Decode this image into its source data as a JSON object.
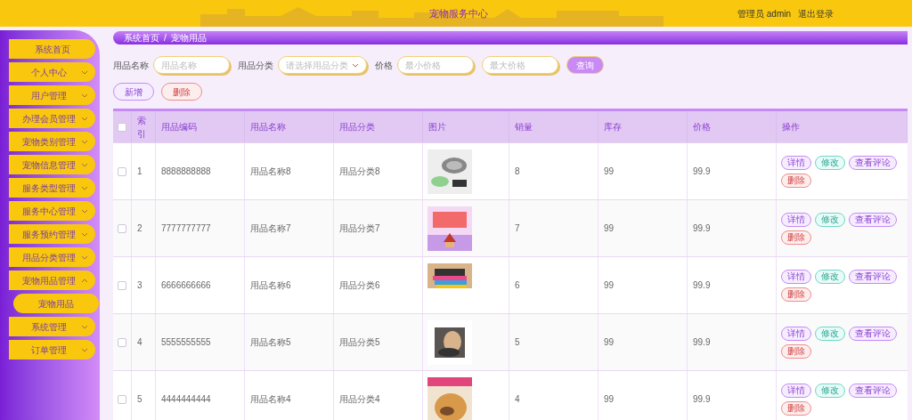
{
  "header": {
    "title": "宠物服务中心",
    "user_label": "管理员 admin",
    "logout": "退出登录"
  },
  "sidebar": {
    "items": [
      {
        "label": "系统首页",
        "kind": "link"
      },
      {
        "label": "个人中心",
        "kind": "menu",
        "expanded": false
      },
      {
        "label": "用户管理",
        "kind": "menu",
        "expanded": false
      },
      {
        "label": "办理会员管理",
        "kind": "menu",
        "expanded": false
      },
      {
        "label": "宠物类别管理",
        "kind": "menu",
        "expanded": false
      },
      {
        "label": "宠物信息管理",
        "kind": "menu",
        "expanded": false
      },
      {
        "label": "服务类型管理",
        "kind": "menu",
        "expanded": false
      },
      {
        "label": "服务中心管理",
        "kind": "menu",
        "expanded": false
      },
      {
        "label": "服务预约管理",
        "kind": "menu",
        "expanded": false
      },
      {
        "label": "用品分类管理",
        "kind": "menu",
        "expanded": false
      },
      {
        "label": "宠物用品管理",
        "kind": "menu",
        "expanded": true,
        "children": [
          {
            "label": "宠物用品"
          }
        ]
      },
      {
        "label": "系统管理",
        "kind": "menu",
        "expanded": false
      },
      {
        "label": "订单管理",
        "kind": "menu",
        "expanded": false
      }
    ]
  },
  "breadcrumb": {
    "items": [
      "系统首页",
      "宠物用品"
    ],
    "separator": "/"
  },
  "filters": [
    {
      "kind": "input",
      "label": "用品名称",
      "placeholder": "用品名称"
    },
    {
      "kind": "select",
      "label": "用品分类",
      "placeholder": "请选择用品分类"
    },
    {
      "kind": "input",
      "label": "价格",
      "placeholder": "最小价格"
    },
    {
      "kind": "input",
      "placeholder": "最大价格"
    }
  ],
  "search_button": "查询",
  "toolbar": [
    {
      "kind": "add",
      "label": "新增"
    },
    {
      "kind": "delete",
      "label": "删除"
    }
  ],
  "table": {
    "select_all": {
      "checked": false
    },
    "columns": [
      "索引",
      "用品编码",
      "用品名称",
      "用品分类",
      "图片",
      "销量",
      "库存",
      "价格",
      "操作"
    ],
    "rows": [
      {
        "checked": false,
        "cells": [
          "1",
          "8888888888",
          "用品名称8",
          "用品分类8"
        ],
        "after": [
          "8",
          "99",
          "99.9"
        ],
        "actions": [
          {
            "kind": "detail",
            "label": "详情"
          },
          {
            "kind": "edit",
            "label": "修改"
          },
          {
            "kind": "comments",
            "label": "查看评论"
          },
          {
            "kind": "delete",
            "label": "删除"
          }
        ]
      },
      {
        "checked": false,
        "cells": [
          "2",
          "7777777777",
          "用品名称7",
          "用品分类7"
        ],
        "after": [
          "7",
          "99",
          "99.9"
        ],
        "actions": [
          {
            "kind": "detail",
            "label": "详情"
          },
          {
            "kind": "edit",
            "label": "修改"
          },
          {
            "kind": "comments",
            "label": "查看评论"
          },
          {
            "kind": "delete",
            "label": "删除"
          }
        ]
      },
      {
        "checked": false,
        "cells": [
          "3",
          "6666666666",
          "用品名称6",
          "用品分类6"
        ],
        "after": [
          "6",
          "99",
          "99.9"
        ],
        "actions": [
          {
            "kind": "detail",
            "label": "详情"
          },
          {
            "kind": "edit",
            "label": "修改"
          },
          {
            "kind": "comments",
            "label": "查看评论"
          },
          {
            "kind": "delete",
            "label": "删除"
          }
        ]
      },
      {
        "checked": false,
        "cells": [
          "4",
          "5555555555",
          "用品名称5",
          "用品分类5"
        ],
        "after": [
          "5",
          "99",
          "99.9"
        ],
        "actions": [
          {
            "kind": "detail",
            "label": "详情"
          },
          {
            "kind": "edit",
            "label": "修改"
          },
          {
            "kind": "comments",
            "label": "查看评论"
          },
          {
            "kind": "delete",
            "label": "删除"
          }
        ]
      },
      {
        "checked": false,
        "cells": [
          "5",
          "4444444444",
          "用品名称4",
          "用品分类4"
        ],
        "after": [
          "4",
          "99",
          "99.9"
        ],
        "actions": [
          {
            "kind": "detail",
            "label": "详情"
          },
          {
            "kind": "edit",
            "label": "修改"
          },
          {
            "kind": "comments",
            "label": "查看评论"
          },
          {
            "kind": "delete",
            "label": "删除"
          }
        ]
      }
    ]
  }
}
